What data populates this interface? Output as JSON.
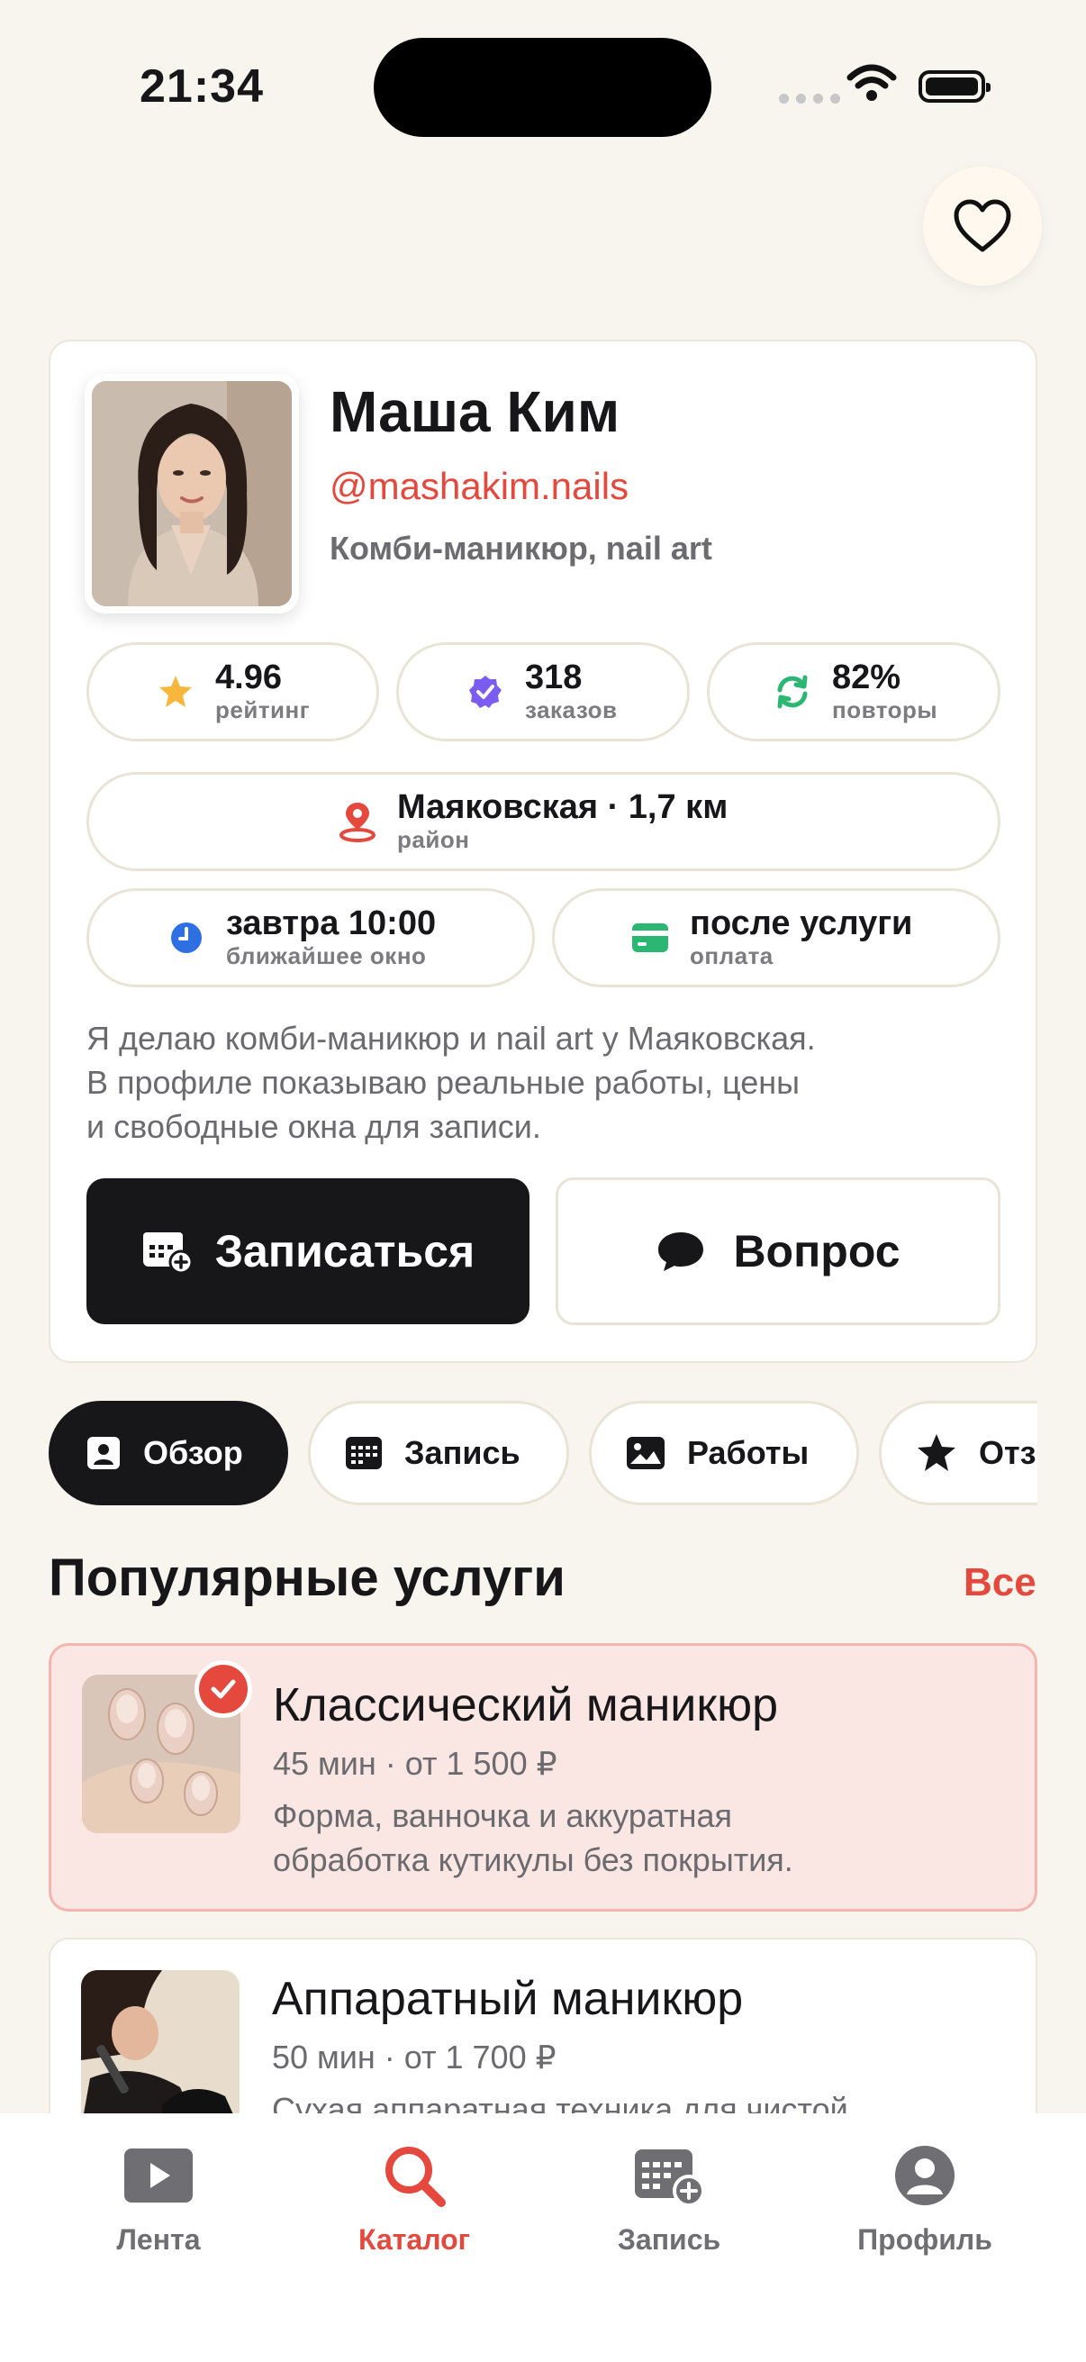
{
  "status_bar": {
    "time": "21:34"
  },
  "profile": {
    "name": "Маша Ким",
    "handle": "@mashakim.nails",
    "specialty": "Комби-маникюр, nail art"
  },
  "stats": [
    {
      "value": "4.96",
      "label": "рейтинг",
      "icon": "star-icon"
    },
    {
      "value": "318",
      "label": "заказов",
      "icon": "verified-badge-icon"
    },
    {
      "value": "82%",
      "label": "повторы",
      "icon": "repeat-icon"
    }
  ],
  "location": {
    "value": "Маяковская · 1,7 км",
    "label": "район",
    "icon": "location-pin-icon"
  },
  "next_slot": {
    "value": "завтра 10:00",
    "label": "ближайшее окно",
    "icon": "clock-icon"
  },
  "payment": {
    "value": "после услуги",
    "label": "оплата",
    "icon": "card-icon"
  },
  "bio": [
    "Я делаю комби-маникюр и nail art у Маяковская.",
    "В профиле показываю реальные работы, цены",
    "и свободные окна для записи."
  ],
  "actions": {
    "book": "Записаться",
    "ask": "Вопрос"
  },
  "tabs": [
    {
      "label": "Обзор",
      "active": true
    },
    {
      "label": "Запись",
      "active": false
    },
    {
      "label": "Работы",
      "active": false
    },
    {
      "label": "Отзывы",
      "active": false
    }
  ],
  "services_section": {
    "title": "Популярные услуги",
    "see_all": "Все"
  },
  "services": [
    {
      "title": "Классический маникюр",
      "meta": "45 мин · от 1 500 ₽",
      "desc": [
        "Форма, ванночка и аккуратная",
        "обработка кутикулы без покрытия."
      ],
      "selected": true
    },
    {
      "title": "Аппаратный маникюр",
      "meta": "50 мин · от 1 700 ₽",
      "desc": [
        "Сухая аппаратная техника для чистой"
      ],
      "selected": false
    }
  ],
  "bottom_nav": [
    {
      "label": "Лента",
      "icon": "play-icon",
      "active": false
    },
    {
      "label": "Каталог",
      "icon": "search-icon",
      "active": true
    },
    {
      "label": "Запись",
      "icon": "calendar-add-icon",
      "active": false
    },
    {
      "label": "Профиль",
      "icon": "person-icon",
      "active": false
    }
  ],
  "colors": {
    "accent": "#E5483D",
    "dark": "#17171A",
    "background": "#F8F5EF"
  }
}
